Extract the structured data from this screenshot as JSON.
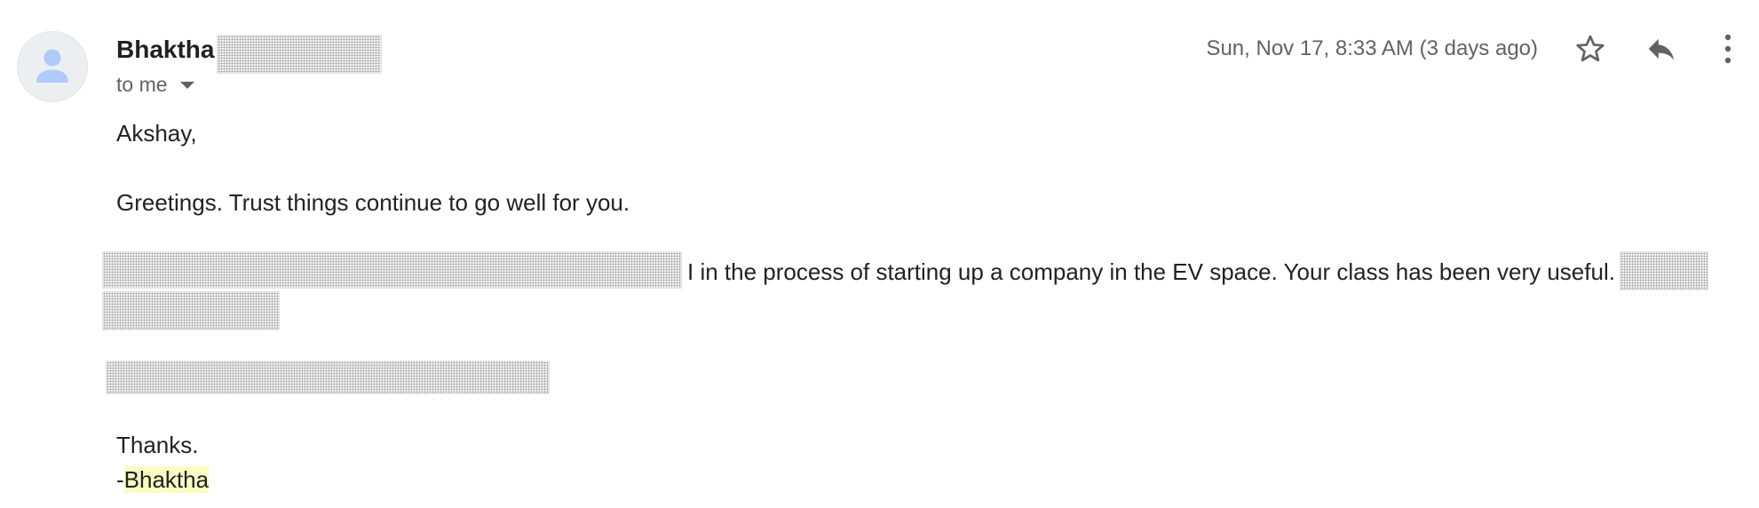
{
  "sender": {
    "name": "Bhaktha",
    "recipients_label": "to me"
  },
  "header": {
    "timestamp": "Sun, Nov 17, 8:33 AM (3 days ago)"
  },
  "icons": {
    "avatar": "person-icon",
    "star": "star-icon",
    "reply": "reply-icon",
    "more": "more-vert-icon",
    "recipients_toggle": "caret-down-icon"
  },
  "message": {
    "salutation": "Akshay,",
    "greeting": "Greetings. Trust things continue to go well for you.",
    "paragraph_visible": "I in the process of starting up a company in the EV space. Your class has been very useful.",
    "closing": "Thanks.",
    "signature_dash": "-",
    "signature_name": "Bhaktha"
  },
  "colors": {
    "highlight": "#fcfbc4",
    "avatar_background": "#eceff1",
    "avatar_figure": "#aecbfa",
    "icon_gray": "#5f6368"
  }
}
